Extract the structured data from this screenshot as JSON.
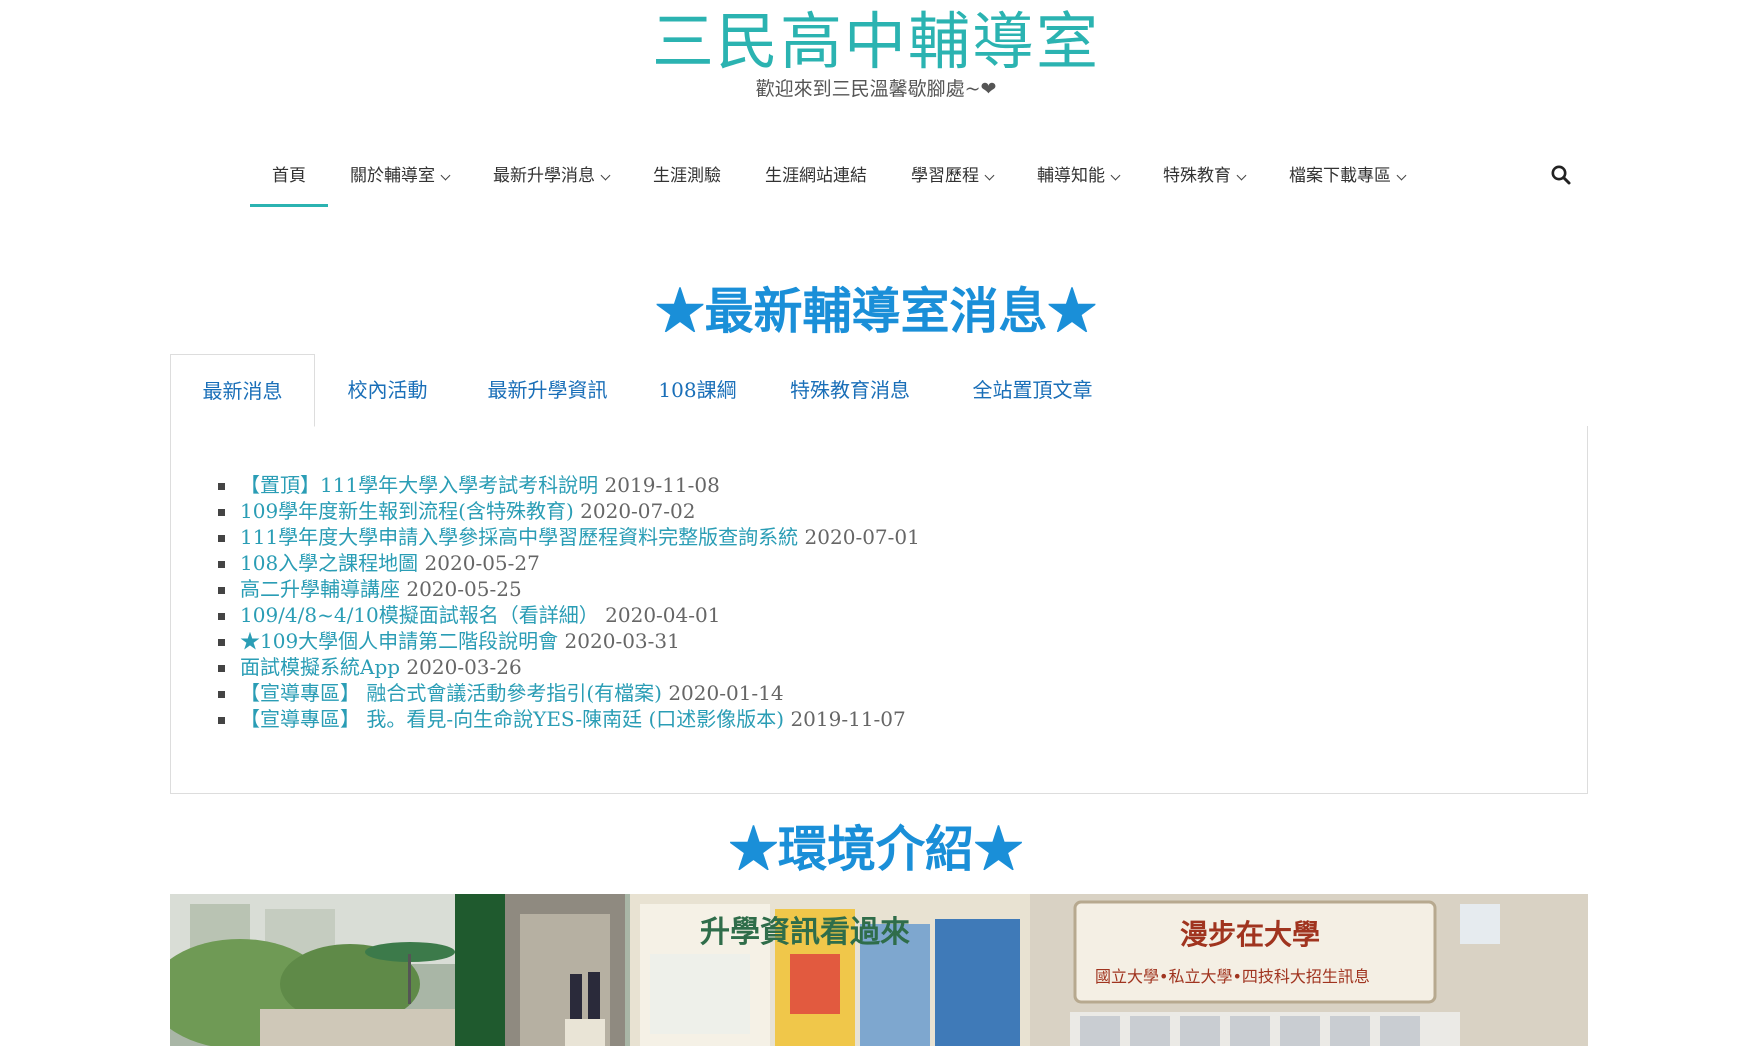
{
  "site": {
    "title": "三民高中輔導室",
    "description": "歡迎來到三民溫馨歇腳處~❤"
  },
  "nav": {
    "items": [
      {
        "label": "首頁",
        "has_dropdown": false,
        "active": true
      },
      {
        "label": "關於輔導室",
        "has_dropdown": true
      },
      {
        "label": "最新升學消息",
        "has_dropdown": true
      },
      {
        "label": "生涯測驗",
        "has_dropdown": false
      },
      {
        "label": "生涯網站連結",
        "has_dropdown": false
      },
      {
        "label": "學習歷程",
        "has_dropdown": true
      },
      {
        "label": "輔導知能",
        "has_dropdown": true
      },
      {
        "label": "特殊教育",
        "has_dropdown": true
      },
      {
        "label": "檔案下載專區",
        "has_dropdown": true
      }
    ],
    "search_icon": "search-icon"
  },
  "news_section": {
    "title": "★最新輔導室消息★",
    "tabs": [
      {
        "label": "最新消息"
      },
      {
        "label": "校內活動"
      },
      {
        "label": "最新升學資訊"
      },
      {
        "label": "108課綱"
      },
      {
        "label": "特殊教育消息"
      },
      {
        "label": "全站置頂文章"
      }
    ],
    "active_tab": "最新消息",
    "items": [
      {
        "title": "【置頂】111學年大學入學考試考科說明",
        "date": "2019-11-08"
      },
      {
        "title": "109學年度新生報到流程(含特殊教育)",
        "date": "2020-07-02"
      },
      {
        "title": "111學年度大學申請入學參採高中學習歷程資料完整版查詢系統",
        "date": "2020-07-01"
      },
      {
        "title": "108入學之課程地圖",
        "date": "2020-05-27"
      },
      {
        "title": "高二升學輔導講座",
        "date": "2020-05-25"
      },
      {
        "title": "109/4/8~4/10模擬面試報名（看詳細）",
        "date": "2020-04-01"
      },
      {
        "title": "★109大學個人申請第二階段說明會",
        "date": "2020-03-31"
      },
      {
        "title": "面試模擬系統App",
        "date": "2020-03-26"
      },
      {
        "title": "【宣導專區】 融合式會議活動參考指引(有檔案)",
        "date": "2020-01-14"
      },
      {
        "title": "【宣導專區】 我。看見-向生命說YES-陳南廷 (口述影像版本)",
        "date": "2019-11-07"
      }
    ]
  },
  "environment_section": {
    "title": "★環境介紹★",
    "photo_banner_texts": [
      "升學資訊看過來",
      "漫步在大學",
      "國立大學•私立大學•四技科大招生訊息"
    ]
  }
}
